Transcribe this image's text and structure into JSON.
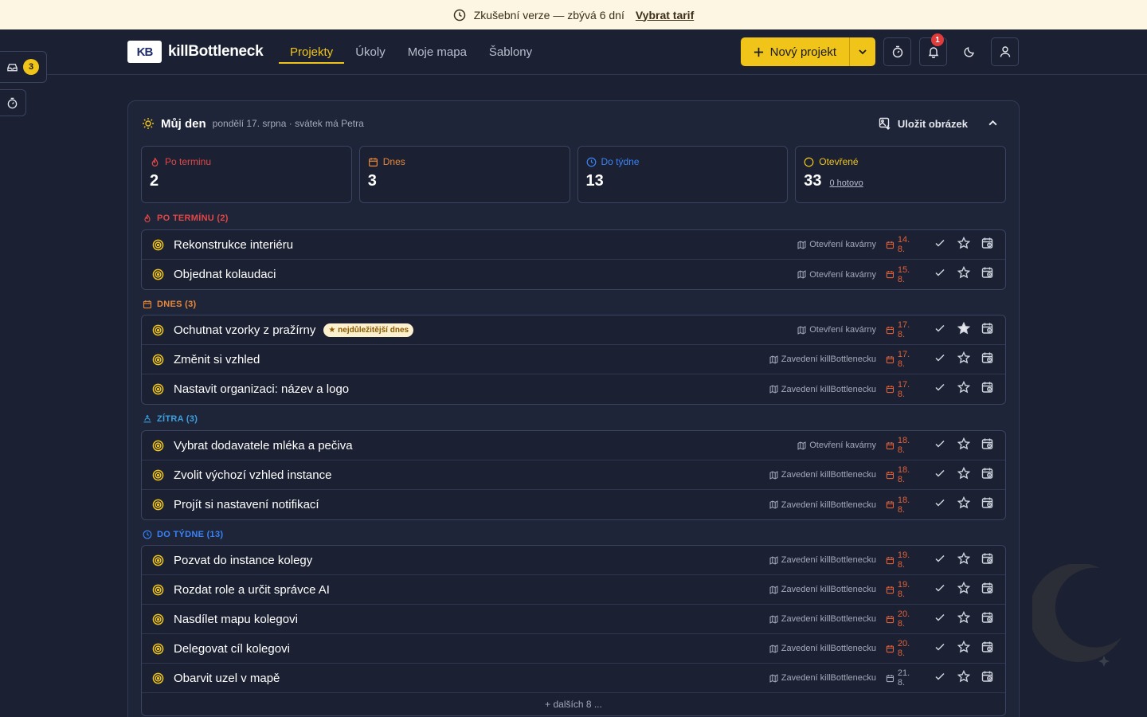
{
  "banner": {
    "text": "Zkušební verze — zbývá 6 dní",
    "link": "Vybrat tarif"
  },
  "logo": {
    "mark": "KB",
    "name": "killBottleneck"
  },
  "nav": [
    {
      "label": "Projekty",
      "active": true
    },
    {
      "label": "Úkoly",
      "active": false
    },
    {
      "label": "Moje mapa",
      "active": false
    },
    {
      "label": "Šablony",
      "active": false
    }
  ],
  "header": {
    "new_project": "Nový projekt",
    "notifications_count": "1"
  },
  "side": {
    "inbox_count": "3"
  },
  "myday": {
    "title": "Můj den",
    "date": "pondělí 17. srpna · svátek má Petra",
    "save_image": "Uložit obrázek"
  },
  "stats": [
    {
      "label": "Po terminu",
      "value": "2",
      "color": "#e24646"
    },
    {
      "label": "Dnes",
      "value": "3",
      "color": "#e8873a"
    },
    {
      "label": "Do týdne",
      "value": "13",
      "color": "#3b82f6"
    },
    {
      "label": "Otevřené",
      "value": "33",
      "sub": "0 hotovo",
      "color": "#f0c419"
    }
  ],
  "sections": {
    "overdue": {
      "label": "PO TERMÍNU (2)",
      "color": "#e24646"
    },
    "today": {
      "label": "DNES (3)",
      "color": "#e8873a"
    },
    "tomorrow": {
      "label": "ZÍTRA (3)",
      "color": "#3aa0e0"
    },
    "week": {
      "label": "DO TÝDNE (13)",
      "color": "#3b82f6"
    }
  },
  "tasks": {
    "overdue": [
      {
        "name": "Rekonstrukce interiéru",
        "project": "Otevření kavárny",
        "due": "14. 8."
      },
      {
        "name": "Objednat kolaudaci",
        "project": "Otevření kavárny",
        "due": "15. 8."
      }
    ],
    "today": [
      {
        "name": "Ochutnat vzorky z pražírny",
        "badge": "★ nejdůležitější dnes",
        "project": "Otevření kavárny",
        "due": "17. 8.",
        "starred": true
      },
      {
        "name": "Změnit si vzhled",
        "project": "Zavedení killBottlenecku",
        "due": "17. 8."
      },
      {
        "name": "Nastavit organizaci: název a logo",
        "project": "Zavedení killBottlenecku",
        "due": "17. 8."
      }
    ],
    "tomorrow": [
      {
        "name": "Vybrat dodavatele mléka a pečiva",
        "project": "Otevření kavárny",
        "due": "18. 8."
      },
      {
        "name": "Zvolit výchozí vzhled instance",
        "project": "Zavedení killBottlenecku",
        "due": "18. 8."
      },
      {
        "name": "Projít si nastavení notifikací",
        "project": "Zavedení killBottlenecku",
        "due": "18. 8."
      }
    ],
    "week": [
      {
        "name": "Pozvat do instance kolegy",
        "project": "Zavedení killBottlenecku",
        "due": "19. 8."
      },
      {
        "name": "Rozdat role a určit správce AI",
        "project": "Zavedení killBottlenecku",
        "due": "19. 8."
      },
      {
        "name": "Nasdílet mapu kolegovi",
        "project": "Zavedení killBottlenecku",
        "due": "20. 8."
      },
      {
        "name": "Delegovat cíl kolegovi",
        "project": "Zavedení killBottlenecku",
        "due": "20. 8."
      },
      {
        "name": "Obarvit uzel v mapě",
        "project": "Zavedení killBottlenecku",
        "due": "21. 8."
      }
    ]
  },
  "more": "+ dalších 8 ..."
}
